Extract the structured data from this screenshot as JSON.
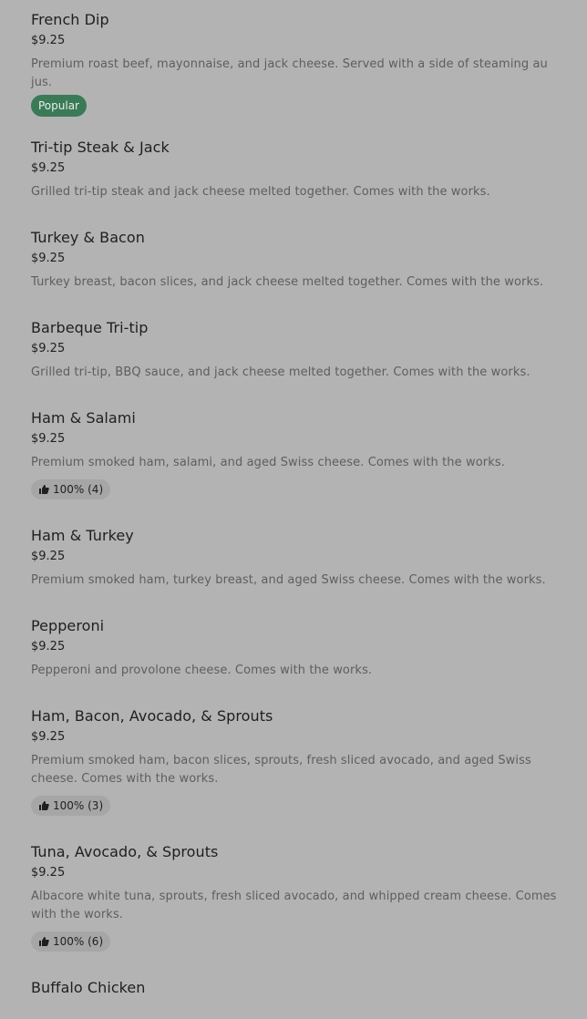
{
  "items": [
    {
      "name": "French Dip",
      "price": "$9.25",
      "description": "Premium roast beef, mayonnaise, and jack cheese. Served with a side of steaming au jus.",
      "badge": "Popular"
    },
    {
      "name": "Tri-tip Steak & Jack",
      "price": "$9.25",
      "description": "Grilled tri-tip steak and jack cheese melted together. Comes with the works."
    },
    {
      "name": "Turkey & Bacon",
      "price": "$9.25",
      "description": "Turkey breast, bacon slices, and jack cheese melted together. Comes with the works."
    },
    {
      "name": "Barbeque Tri-tip",
      "price": "$9.25",
      "description": "Grilled tri-tip, BBQ sauce, and jack cheese melted together. Comes with the works."
    },
    {
      "name": "Ham & Salami",
      "price": "$9.25",
      "description": "Premium smoked ham, salami, and aged Swiss cheese. Comes with the works.",
      "rating": "100% (4)"
    },
    {
      "name": "Ham & Turkey",
      "price": "$9.25",
      "description": "Premium smoked ham, turkey breast, and aged Swiss cheese. Comes with the works."
    },
    {
      "name": "Pepperoni",
      "price": "$9.25",
      "description": "Pepperoni and provolone cheese. Comes with the works."
    },
    {
      "name": "Ham, Bacon, Avocado, & Sprouts",
      "price": "$9.25",
      "description": "Premium smoked ham, bacon slices, sprouts, fresh sliced avocado, and aged Swiss cheese. Comes with the works.",
      "rating": "100% (3)"
    },
    {
      "name": "Tuna, Avocado, & Sprouts",
      "price": "$9.25",
      "description": "Albacore white tuna, sprouts, fresh sliced avocado, and whipped cream cheese. Comes with the works.",
      "rating": "100% (6)"
    },
    {
      "name": "Buffalo Chicken"
    }
  ],
  "icons": {
    "rating_icon": "thumbs-up-icon"
  },
  "colors": {
    "popular_badge_bg": "#3a7a57",
    "rating_badge_bg": "#a6a6a6",
    "overlay_bg": "#b3b3b3"
  }
}
